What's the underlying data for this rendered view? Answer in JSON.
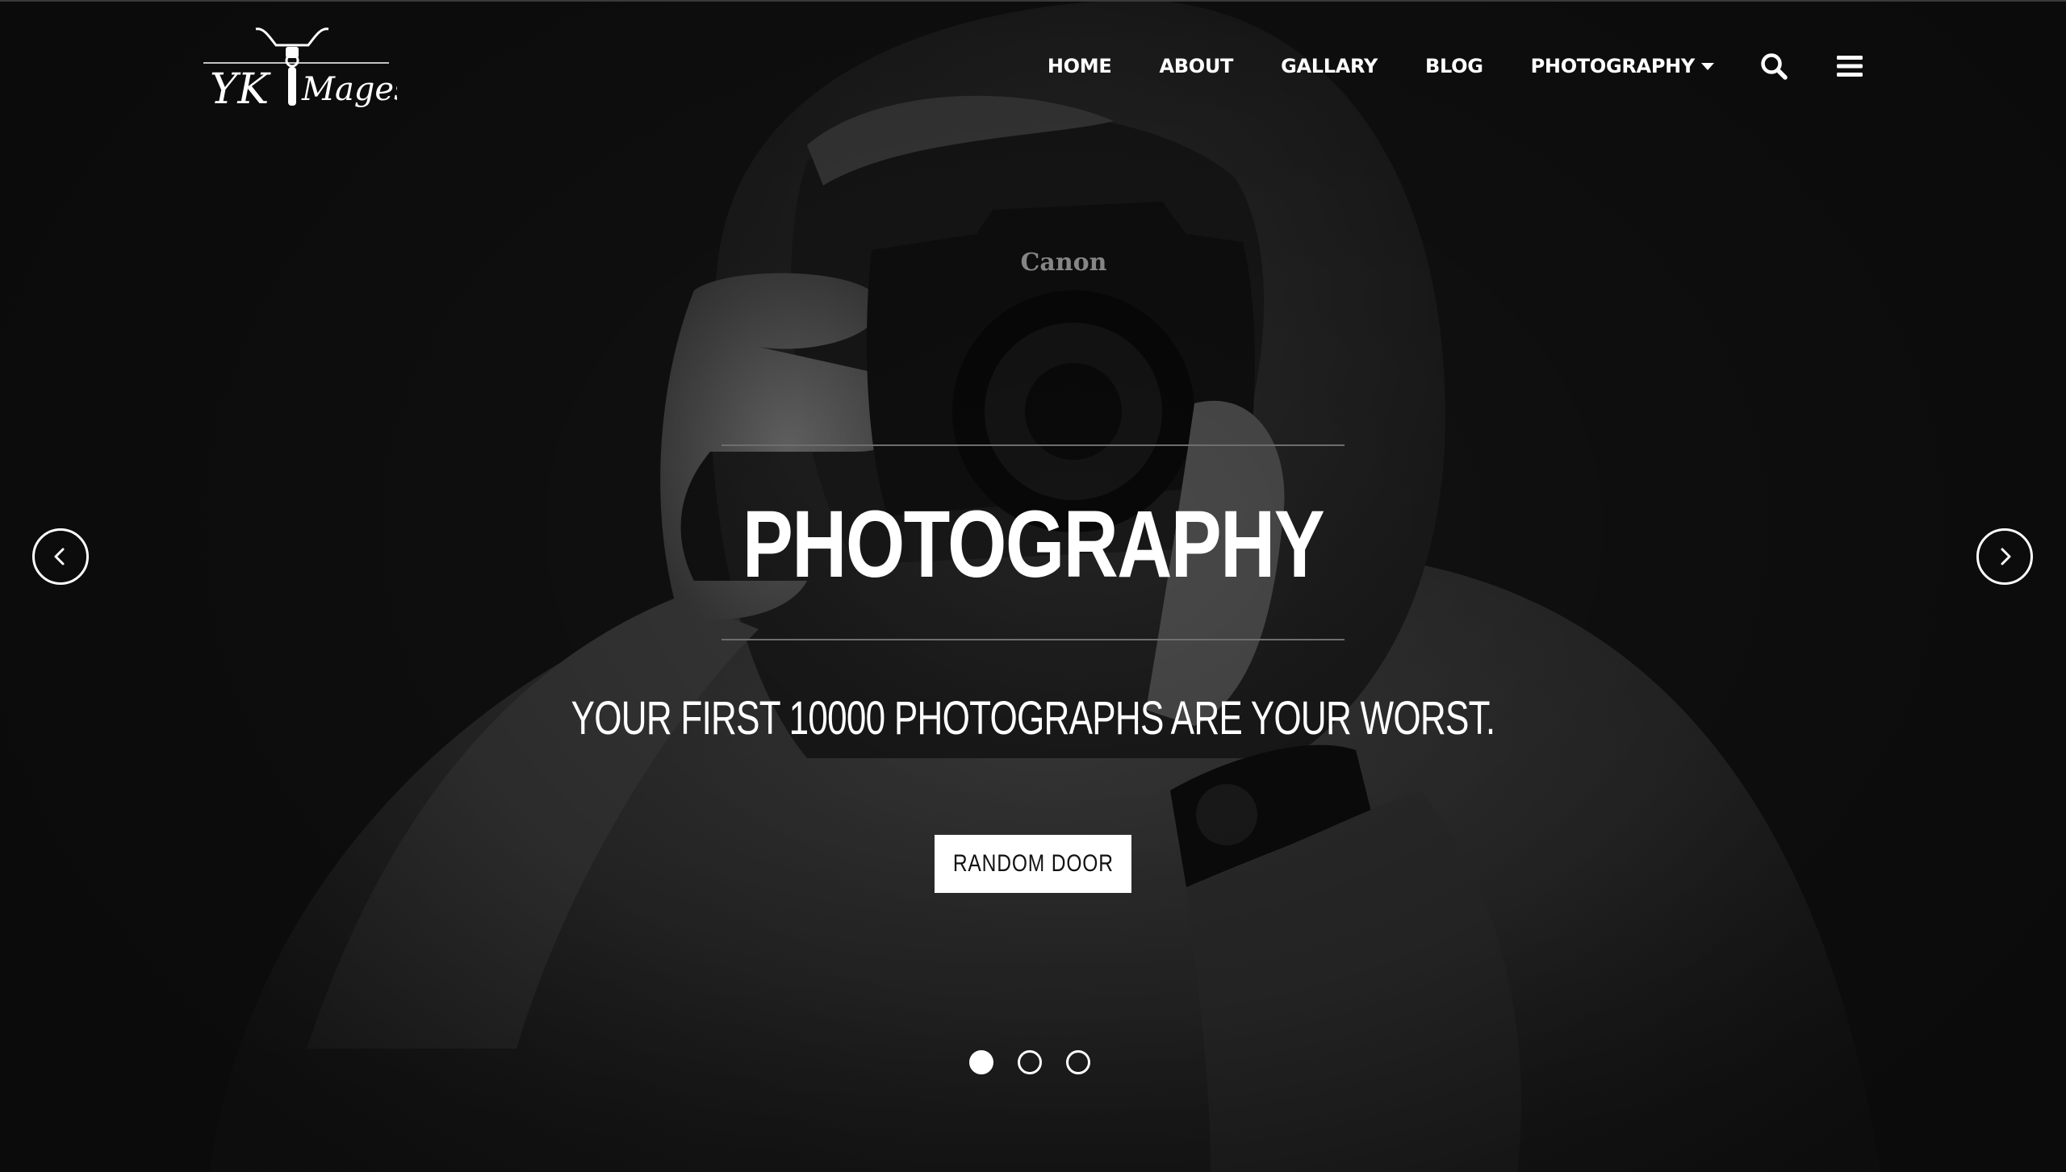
{
  "brand": {
    "logo_text": "YK Mages",
    "logo_icon": "motorcycle-icon"
  },
  "nav": {
    "items": [
      {
        "label": "HOME"
      },
      {
        "label": "ABOUT"
      },
      {
        "label": "GALLARY"
      },
      {
        "label": "BLOG"
      },
      {
        "label": "PHOTOGRAPHY",
        "has_dropdown": true
      }
    ],
    "search_icon": "search-icon",
    "menu_icon": "hamburger-menu-icon"
  },
  "slider": {
    "title": "PHOTOGRAPHY",
    "subtitle": "YOUR FIRST 10000 PHOTOGRAPHS ARE YOUR WORST.",
    "button_label": "RANDOM DOOR",
    "background_image": "person in hoodie holding Canon camera (black & white)",
    "camera_brand_text": "Canon",
    "prev_icon": "chevron-left-icon",
    "next_icon": "chevron-right-icon",
    "slide_count": 3,
    "active_slide": 1
  },
  "colors": {
    "background": "#111111",
    "text": "#ffffff",
    "button_bg": "#ffffff",
    "button_text": "#111111"
  }
}
